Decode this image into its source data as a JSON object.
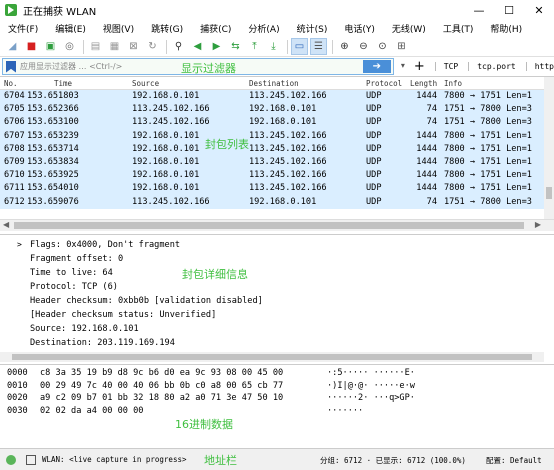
{
  "window": {
    "title": "正在捕获 WLAN",
    "controls": [
      "—",
      "☐",
      "✕"
    ]
  },
  "menu": [
    "文件(F)",
    "编辑(E)",
    "视图(V)",
    "跳转(G)",
    "捕获(C)",
    "分析(A)",
    "统计(S)",
    "电话(Y)",
    "无线(W)",
    "工具(T)",
    "帮助(H)"
  ],
  "toolbar_icons": [
    {
      "name": "start-capture-icon",
      "glyph": "◢",
      "color": "#7aa0c8"
    },
    {
      "name": "stop-capture-icon",
      "glyph": "■",
      "color": "#d62020"
    },
    {
      "name": "restart-capture-icon",
      "glyph": "▣",
      "color": "#2e9e3e"
    },
    {
      "name": "capture-options-icon",
      "glyph": "◎",
      "color": "#666"
    },
    {
      "name": "open-file-icon",
      "glyph": "▤",
      "color": "#999"
    },
    {
      "name": "save-file-icon",
      "glyph": "▦",
      "color": "#999"
    },
    {
      "name": "close-file-icon",
      "glyph": "⊠",
      "color": "#888"
    },
    {
      "name": "reload-icon",
      "glyph": "↻",
      "color": "#888"
    },
    {
      "name": "find-packet-icon",
      "glyph": "⚲",
      "color": "#333"
    },
    {
      "name": "go-back-icon",
      "glyph": "◀",
      "color": "#2e9e3e"
    },
    {
      "name": "go-forward-icon",
      "glyph": "▶",
      "color": "#2e9e3e"
    },
    {
      "name": "go-to-packet-icon",
      "glyph": "⇆",
      "color": "#2e9e3e"
    },
    {
      "name": "go-first-icon",
      "glyph": "⤒",
      "color": "#2e9e3e"
    },
    {
      "name": "go-last-icon",
      "glyph": "⤓",
      "color": "#2e9e3e"
    },
    {
      "name": "autoscroll-icon",
      "glyph": "▭",
      "color": "#2b64b8",
      "active": true
    },
    {
      "name": "colorize-icon",
      "glyph": "☰",
      "color": "#555",
      "active": true
    },
    {
      "name": "zoom-in-icon",
      "glyph": "⊕",
      "color": "#333"
    },
    {
      "name": "zoom-out-icon",
      "glyph": "⊖",
      "color": "#333"
    },
    {
      "name": "zoom-normal-icon",
      "glyph": "⊙",
      "color": "#333"
    },
    {
      "name": "resize-columns-icon",
      "glyph": "⊞",
      "color": "#555"
    }
  ],
  "filter": {
    "placeholder": "应用显示过滤器 … <Ctrl-/>",
    "apply_glyph": "➔",
    "dropdown_glyph": "▾",
    "add_glyph": "+",
    "buttons": [
      "TCP",
      "tcp.port",
      "http"
    ],
    "overlay_label": "显示过滤器"
  },
  "packet_list": {
    "columns": [
      "No.",
      "Time",
      "Source",
      "Destination",
      "Protocol",
      "Length",
      "Info"
    ],
    "rows": [
      [
        "6704",
        "153.651803",
        "192.168.0.101",
        "113.245.102.166",
        "UDP",
        "1444",
        "7800 → 1751 Len=1"
      ],
      [
        "6705",
        "153.652366",
        "113.245.102.166",
        "192.168.0.101",
        "UDP",
        "74",
        "1751 → 7800 Len=3"
      ],
      [
        "6706",
        "153.653100",
        "113.245.102.166",
        "192.168.0.101",
        "UDP",
        "74",
        "1751 → 7800 Len=3"
      ],
      [
        "6707",
        "153.653239",
        "192.168.0.101",
        "113.245.102.166",
        "UDP",
        "1444",
        "7800 → 1751 Len=1"
      ],
      [
        "6708",
        "153.653714",
        "192.168.0.101",
        "113.245.102.166",
        "UDP",
        "1444",
        "7800 → 1751 Len=1"
      ],
      [
        "6709",
        "153.653834",
        "192.168.0.101",
        "113.245.102.166",
        "UDP",
        "1444",
        "7800 → 1751 Len=1"
      ],
      [
        "6710",
        "153.653925",
        "192.168.0.101",
        "113.245.102.166",
        "UDP",
        "1444",
        "7800 → 1751 Len=1"
      ],
      [
        "6711",
        "153.654010",
        "192.168.0.101",
        "113.245.102.166",
        "UDP",
        "1444",
        "7800 → 1751 Len=1"
      ],
      [
        "6712",
        "153.659076",
        "113.245.102.166",
        "192.168.0.101",
        "UDP",
        "74",
        "1751 → 7800 Len=3"
      ]
    ],
    "row_color": "#daeeff",
    "overlay_label": "封包列表"
  },
  "details": {
    "expander": ">",
    "lines": [
      "Flags: 0x4000, Don't fragment",
      "Fragment offset: 0",
      "Time to live: 64",
      "Protocol: TCP (6)",
      "Header checksum: 0xbb0b [validation disabled]",
      "[Header checksum status: Unverified]",
      "Source: 192.168.0.101",
      "Destination: 203.119.169.194"
    ],
    "overlay_label": "封包详细信息"
  },
  "bytes": {
    "rows": [
      {
        "offset": "0000",
        "hex": "c8 3a 35 19 b9 d8 9c b6  d0 ea 9c 93 08 00 45 00",
        "ascii": "·:5····· ······E·"
      },
      {
        "offset": "0010",
        "hex": "00 29 49 7c 40 00 40 06  bb 0b c0 a8 00 65 cb 77",
        "ascii": "·)I|@·@· ·····e·w"
      },
      {
        "offset": "0020",
        "hex": "a9 c2 09 b7 01 bb 32 18  80 a2 a0 71 3e 47 50 10",
        "ascii": "······2· ···q>GP·"
      },
      {
        "offset": "0030",
        "hex": "02 02 da a4 00 00 00",
        "ascii": "·······"
      }
    ],
    "overlay_label": "16进制数据"
  },
  "status": {
    "capture_text": "WLAN: <live capture in progress>",
    "overlay_label": "地址栏",
    "counts": "分组: 6712 · 已显示: 6712 (100.0%)",
    "profile": "配置: Default"
  }
}
